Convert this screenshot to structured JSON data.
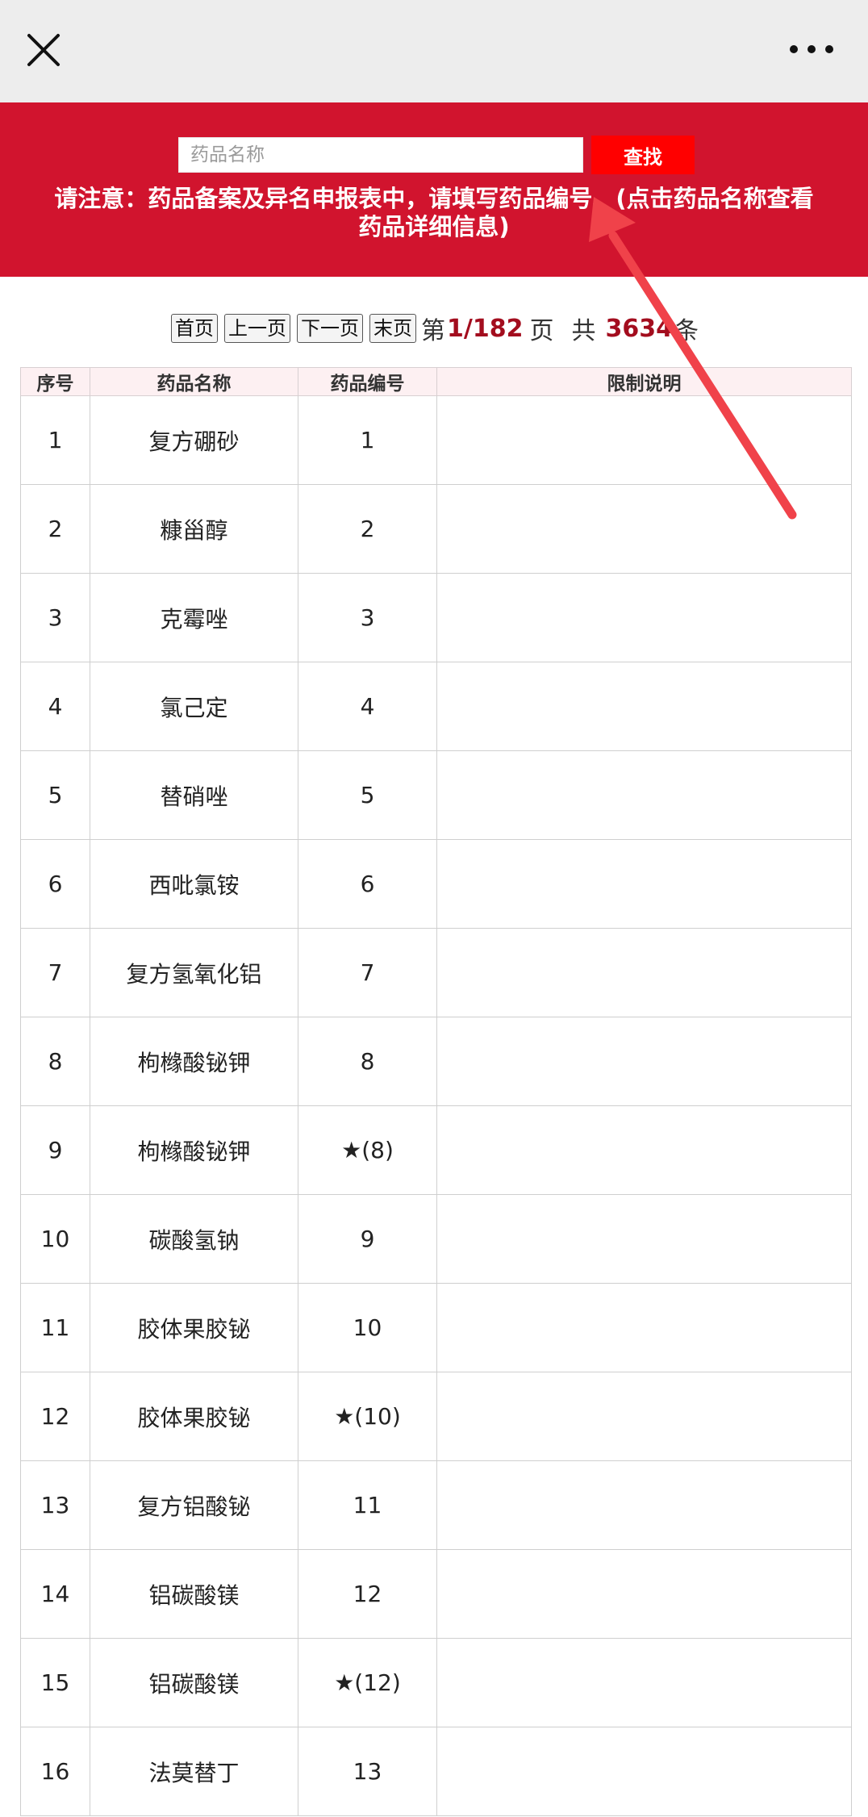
{
  "header": {
    "close_icon": "close-icon",
    "more_icon": "more-dots-icon"
  },
  "search": {
    "placeholder": "药品名称",
    "value": "",
    "button_label": "查找",
    "notice_line1": "请注意：药品备案及异名申报表中，请填写药品编号。(点击药品名称查看",
    "notice_line2": "药品详细信息)"
  },
  "pager": {
    "first": "首页",
    "prev": "上一页",
    "next": "下一页",
    "last": "末页",
    "page_prefix": "第",
    "current_total": "1/182",
    "page_suffix": "页",
    "total_prefix": "共",
    "total_count": "3634",
    "total_suffix": "条"
  },
  "table": {
    "columns": [
      "序号",
      "药品名称",
      "药品编号",
      "限制说明"
    ],
    "rows": [
      {
        "seq": "1",
        "name": "复方硼砂",
        "code": "1",
        "note": ""
      },
      {
        "seq": "2",
        "name": "糠甾醇",
        "code": "2",
        "note": ""
      },
      {
        "seq": "3",
        "name": "克霉唑",
        "code": "3",
        "note": ""
      },
      {
        "seq": "4",
        "name": "氯己定",
        "code": "4",
        "note": ""
      },
      {
        "seq": "5",
        "name": "替硝唑",
        "code": "5",
        "note": ""
      },
      {
        "seq": "6",
        "name": "西吡氯铵",
        "code": "6",
        "note": ""
      },
      {
        "seq": "7",
        "name": "复方氢氧化铝",
        "code": "7",
        "note": ""
      },
      {
        "seq": "8",
        "name": "枸橼酸铋钾",
        "code": "8",
        "note": ""
      },
      {
        "seq": "9",
        "name": "枸橼酸铋钾",
        "code": "★(8)",
        "note": ""
      },
      {
        "seq": "10",
        "name": "碳酸氢钠",
        "code": "9",
        "note": ""
      },
      {
        "seq": "11",
        "name": "胶体果胶铋",
        "code": "10",
        "note": ""
      },
      {
        "seq": "12",
        "name": "胶体果胶铋",
        "code": "★(10)",
        "note": ""
      },
      {
        "seq": "13",
        "name": "复方铝酸铋",
        "code": "11",
        "note": ""
      },
      {
        "seq": "14",
        "name": "铝碳酸镁",
        "code": "12",
        "note": ""
      },
      {
        "seq": "15",
        "name": "铝碳酸镁",
        "code": "★(12)",
        "note": ""
      },
      {
        "seq": "16",
        "name": "法莫替丁",
        "code": "13",
        "note": ""
      }
    ]
  },
  "colors": {
    "header_red": "#d1142e",
    "button_red": "#ff0000",
    "number_dark_red": "#a30d1e",
    "arrow_red": "#f0424a"
  }
}
